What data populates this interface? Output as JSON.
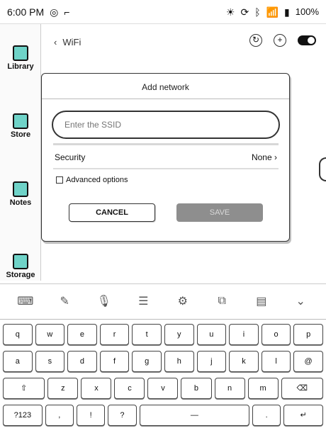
{
  "status": {
    "time": "6:00 PM",
    "battery": "100%"
  },
  "sidebar": {
    "items": [
      {
        "label": "Library"
      },
      {
        "label": "Store"
      },
      {
        "label": "Notes"
      },
      {
        "label": "Storage"
      }
    ]
  },
  "topbar": {
    "title": "WiFi"
  },
  "dialog": {
    "title": "Add network",
    "ssid_placeholder": "Enter the SSID",
    "security_label": "Security",
    "security_value": "None",
    "advanced_label": "Advanced options",
    "cancel_label": "CANCEL",
    "save_label": "SAVE"
  },
  "keyboard": {
    "row1": [
      "q",
      "w",
      "e",
      "r",
      "t",
      "y",
      "u",
      "i",
      "o",
      "p"
    ],
    "row2": [
      "a",
      "s",
      "d",
      "f",
      "g",
      "h",
      "j",
      "k",
      "l",
      "@"
    ],
    "row3": [
      "⇧",
      "z",
      "x",
      "c",
      "v",
      "b",
      "n",
      "m",
      "⌫"
    ],
    "row4": [
      "?123",
      ",",
      "!",
      "?",
      "—",
      ".",
      "↵"
    ]
  }
}
